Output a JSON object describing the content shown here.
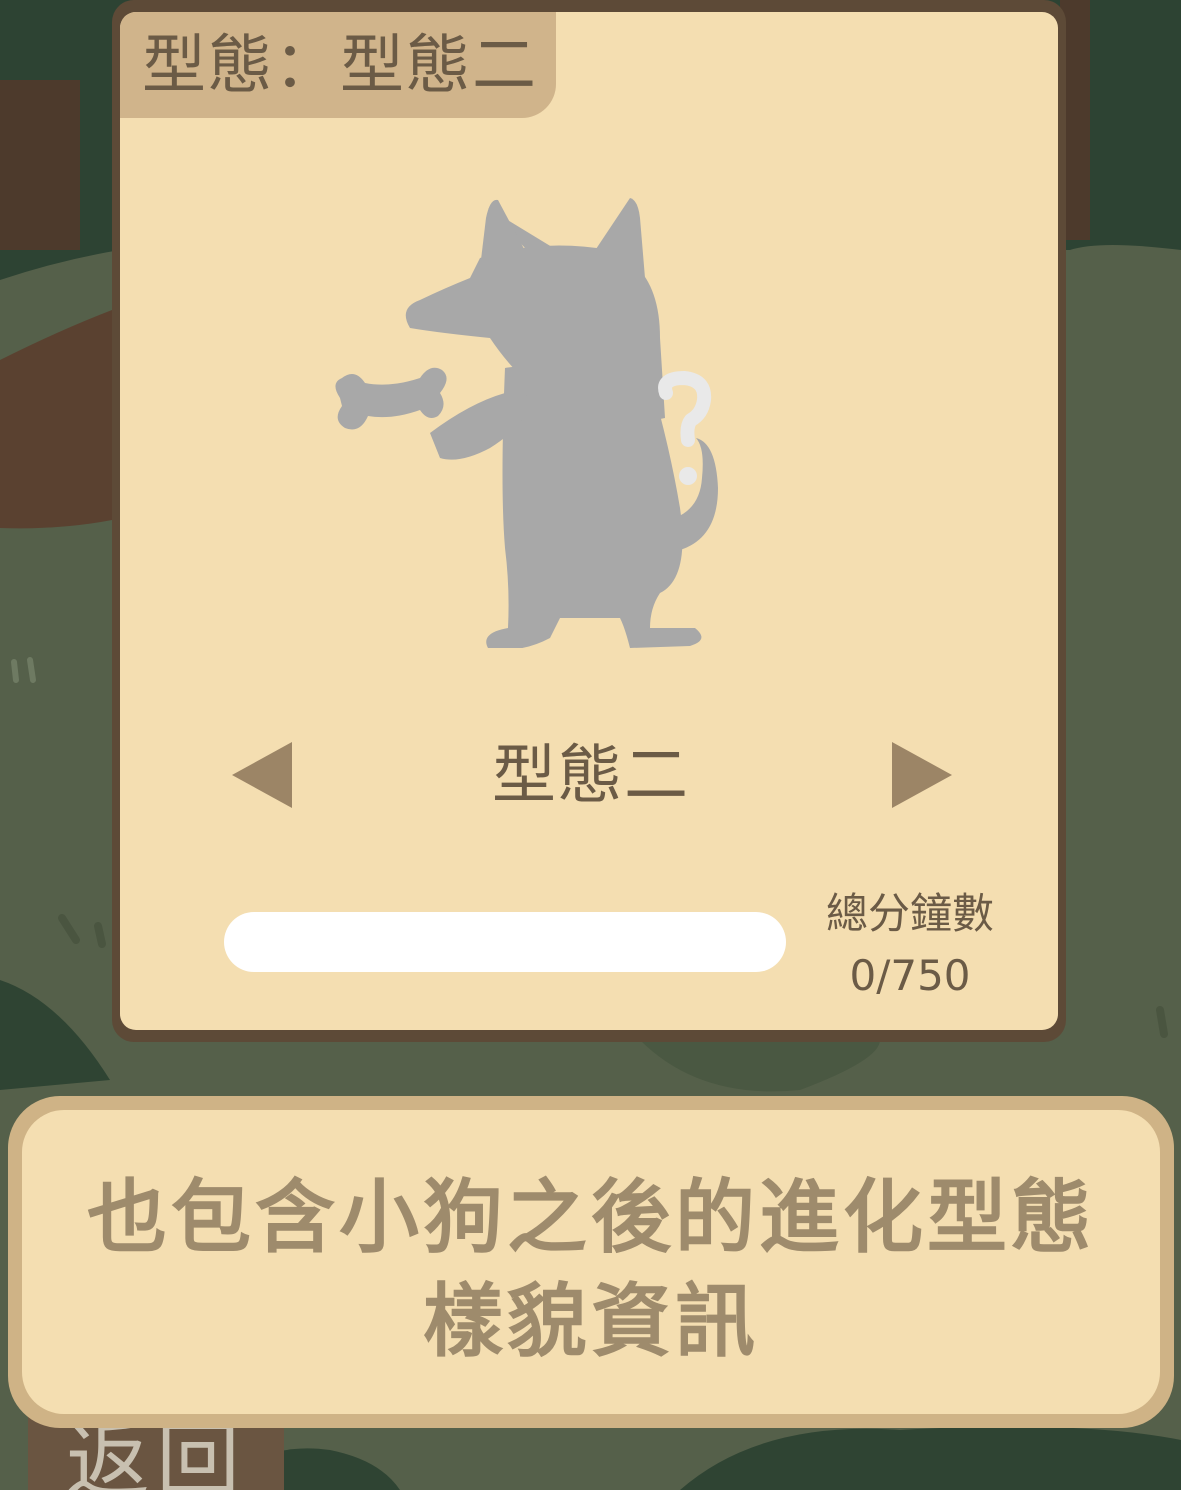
{
  "form_panel": {
    "header_label": "型態：型態二",
    "form_name": "型態二",
    "dog_silhouette_icon": "locked-dog-silhouette-with-question-mark",
    "prev_icon": "triangle-left-icon",
    "next_icon": "triangle-right-icon",
    "total_minutes_label": "總分鐘數",
    "total_minutes_value": "0/750",
    "progress_fraction": 0
  },
  "message": {
    "line1": "也包含小狗之後的進化型態",
    "line2": "樣貌資訊"
  },
  "back_button": {
    "label": "返回"
  },
  "colors": {
    "panel": "#f4deb1",
    "panel_border": "#5d4a37",
    "tab": "#d0b48b",
    "text": "#6b5b46",
    "arrow": "#9c8566",
    "message_text": "#9e8b6c",
    "silhouette": "#a8a8a8",
    "background": "#55604a"
  }
}
